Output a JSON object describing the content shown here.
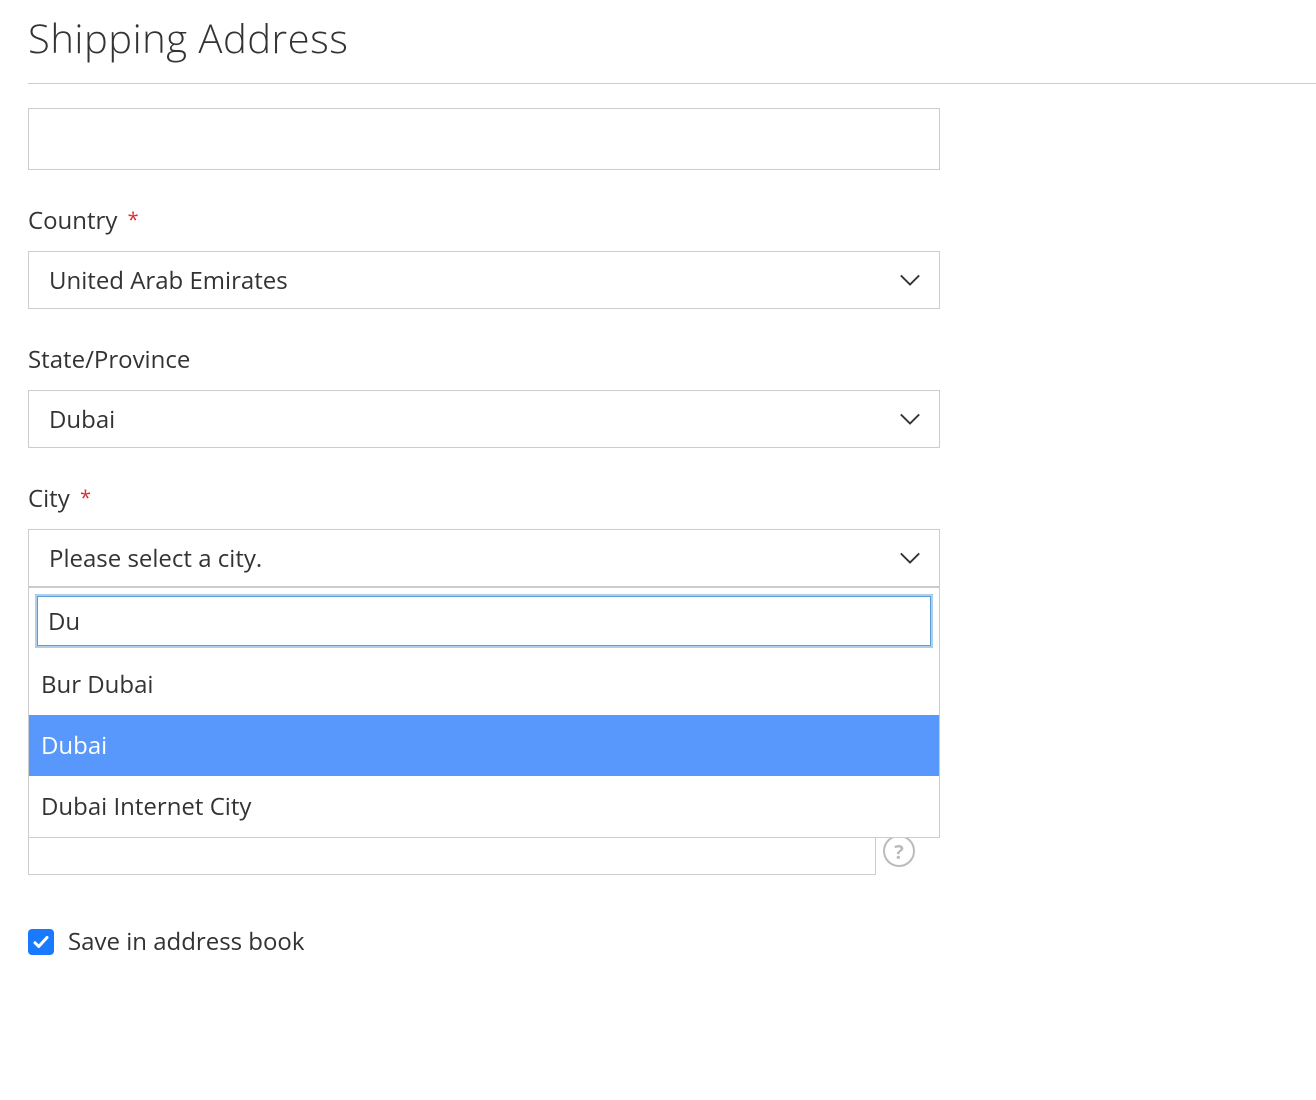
{
  "heading": "Shipping Address",
  "fields": {
    "country": {
      "label": "Country",
      "required": true,
      "value": "United Arab Emirates"
    },
    "state": {
      "label": "State/Province",
      "required": false,
      "value": "Dubai"
    },
    "city": {
      "label": "City",
      "required": true,
      "placeholder": "Please select a city.",
      "search_value": "Du",
      "options": [
        "Bur Dubai",
        "Dubai",
        "Dubai Internet City"
      ],
      "highlighted_index": 1
    }
  },
  "save_checkbox": {
    "label": "Save in address book",
    "checked": true
  },
  "required_marker": "*"
}
